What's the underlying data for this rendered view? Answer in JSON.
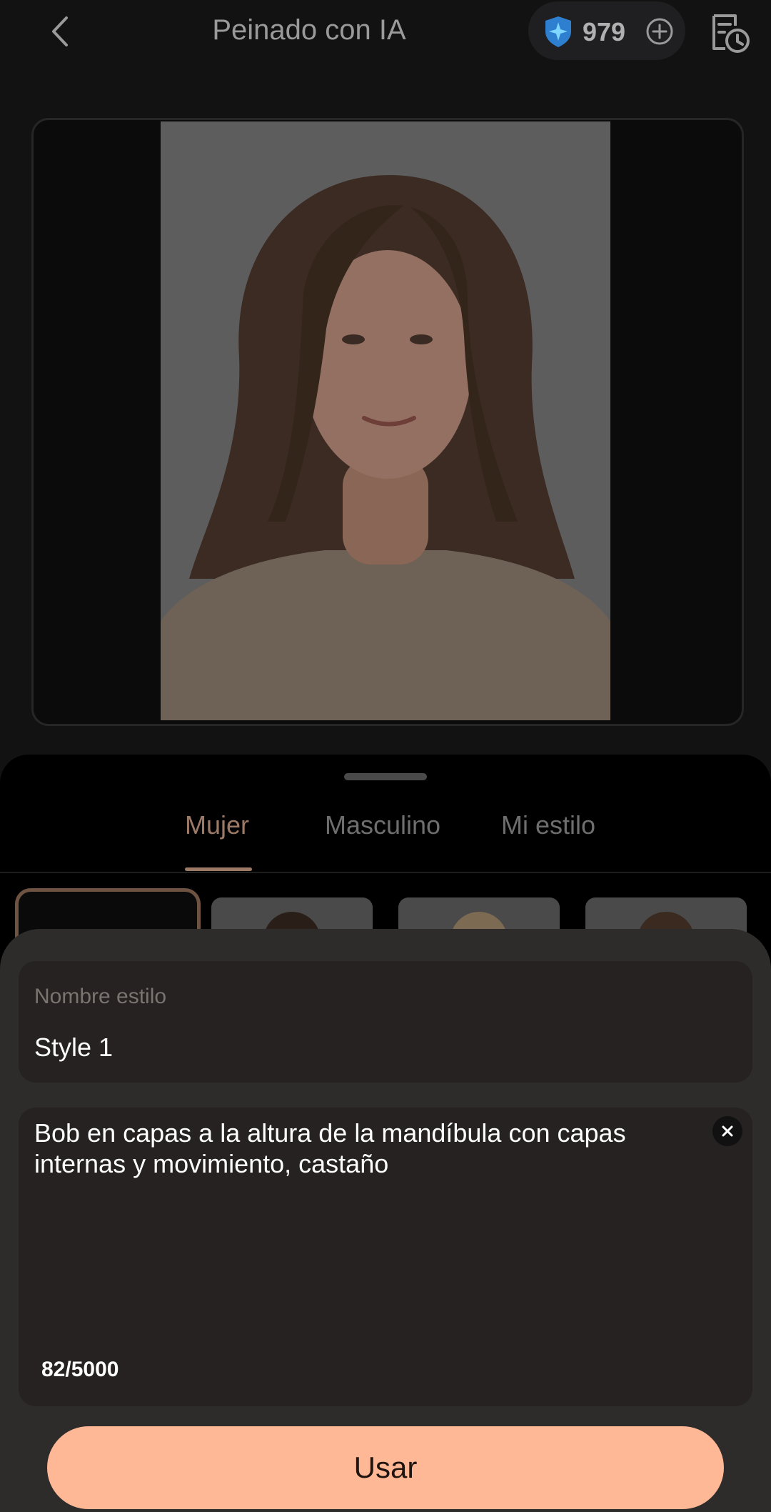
{
  "header": {
    "title": "Peinado con IA",
    "credits": "979",
    "icons": {
      "back": "chevron-left-icon",
      "credit": "shield-sparkle-icon",
      "add": "plus-circle-icon",
      "history": "history-clock-icon"
    }
  },
  "tabs": [
    {
      "label": "Mujer",
      "active": true
    },
    {
      "label": "Masculino",
      "active": false
    },
    {
      "label": "Mi estilo",
      "active": false
    }
  ],
  "style_form": {
    "name_label": "Nombre estilo",
    "name_value": "Style 1",
    "description": "Bob en capas a la altura de la mandíbula con capas internas y movimiento, castaño",
    "counter": "82/5000",
    "submit_label": "Usar"
  },
  "colors": {
    "accent": "#ffb896",
    "tab_active": "#9c7a66",
    "panel_bg": "#2e2b2b"
  }
}
